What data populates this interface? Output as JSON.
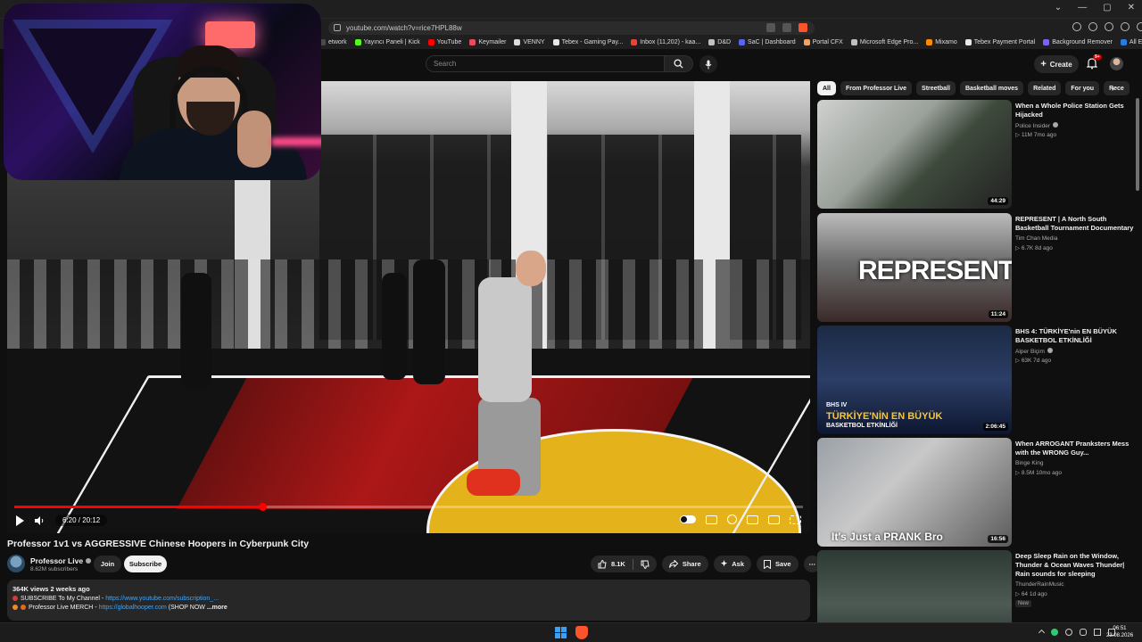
{
  "browser": {
    "url": "youtube.com/watch?v=rice7HPL88w",
    "bookmarks": [
      {
        "label": "etwork",
        "color": "#4a4a4a"
      },
      {
        "label": "Yayıncı Paneli | Kick",
        "color": "#53fc18"
      },
      {
        "label": "YouTube",
        "color": "#ff0000"
      },
      {
        "label": "Keymailer",
        "color": "#e84a5f"
      },
      {
        "label": "VENNY",
        "color": "#dddddd"
      },
      {
        "label": "Tebex - Gaming Pay...",
        "color": "#e8e8e8"
      },
      {
        "label": "Inbox (11,202) - kaa...",
        "color": "#ea4335"
      },
      {
        "label": "D&D",
        "color": "#c0c0c0"
      },
      {
        "label": "SaC | Dashboard",
        "color": "#5865f2"
      },
      {
        "label": "Portal CFX",
        "color": "#f4a261"
      },
      {
        "label": "Microsoft Edge Pro...",
        "color": "#c0c0c0"
      },
      {
        "label": "Mixamo",
        "color": "#ff8c00"
      },
      {
        "label": "Tebex Payment Portal",
        "color": "#e8e8e8"
      },
      {
        "label": "Background Remover",
        "color": "#7b61ff"
      },
      {
        "label": "All Entries - Entries |...",
        "color": "#2a7ae2"
      }
    ]
  },
  "header": {
    "search_placeholder": "Search",
    "create_label": "Create",
    "notification_count": "9+"
  },
  "video": {
    "title": "Professor 1v1 vs AGGRESSIVE Chinese Hoopers in Cyberpunk City",
    "time": "6:20 / 20:12",
    "progress": 0.314,
    "channel_name": "Professor Live",
    "subscribers": "8.62M subscribers",
    "join_label": "Join",
    "subscribe_label": "Subscribe",
    "like_count": "8.1K",
    "share_label": "Share",
    "ask_label": "Ask",
    "save_label": "Save"
  },
  "description": {
    "meta": "364K views  2 weeks ago",
    "line1_text": "SUBSCRIBE To My Channel - ",
    "line1_link": "https://www.youtube.com/subscription_...",
    "line2_text": "Professor Live MERCH - ",
    "line2_link": "https://globalhooper.com",
    "line2_suffix": " (SHOP NOW ",
    "more_label": "...more"
  },
  "chips": [
    {
      "label": "All",
      "active": true
    },
    {
      "label": "From Professor Live",
      "active": false
    },
    {
      "label": "Streetball",
      "active": false
    },
    {
      "label": "Basketball moves",
      "active": false
    },
    {
      "label": "Related",
      "active": false
    },
    {
      "label": "For you",
      "active": false
    },
    {
      "label": "Rece",
      "active": false
    }
  ],
  "recommendations": [
    {
      "title": "When a Whole Police Station Gets Hijacked",
      "channel": "Police Insider",
      "verified": true,
      "meta": "11M  7mo ago",
      "duration": "44:29",
      "badge": ""
    },
    {
      "title": "REPRESENT | A North South Basketball Tournament Documentary",
      "channel": "Tim Chan Media",
      "verified": false,
      "meta": "6.7K  8d ago",
      "duration": "11:24",
      "badge": ""
    },
    {
      "title": "BHS 4: TÜRKİYE'nin EN BÜYÜK BASKETBOL ETKİNLİĞİ",
      "channel": "Alper Biçim",
      "verified": true,
      "meta": "63K  7d ago",
      "duration": "2:06:45",
      "badge": ""
    },
    {
      "title": "When ARROGANT Pranksters Mess with the WRONG Guy...",
      "channel": "Binge King",
      "verified": false,
      "meta": "8.5M  10mo ago",
      "duration": "16:56",
      "badge": ""
    },
    {
      "title": "Deep Sleep Rain on the Window, Thunder & Ocean Waves  Thunder| Rain sounds for sleeping",
      "channel": "ThunderRainMusic",
      "verified": false,
      "meta": "64  1d ago",
      "duration": "",
      "badge": "New"
    }
  ],
  "thumb_text": {
    "represent": "REPRESENT",
    "bhs_top": "BHS IV",
    "bhs_main": "TÜRKİYE'NİN EN BÜYÜK",
    "bhs_sub": "BASKETBOL ETKİNLİĞİ",
    "prank": "It's Just a PRANK Bro"
  },
  "taskbar": {
    "time": "06:51",
    "date": "23.08.2026"
  }
}
